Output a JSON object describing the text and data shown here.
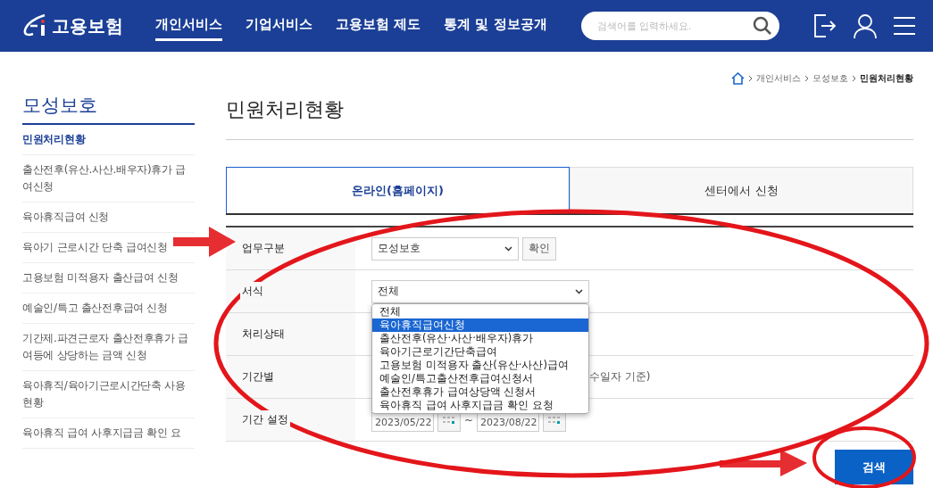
{
  "header": {
    "logo": "고용보험",
    "nav": [
      {
        "label": "개인서비스",
        "selected": true
      },
      {
        "label": "기업서비스",
        "selected": false
      },
      {
        "label": "고용보험 제도",
        "selected": false
      },
      {
        "label": "통계 및 정보공개",
        "selected": false
      }
    ],
    "search": {
      "placeholder": "검색어를 입력하세요."
    }
  },
  "breadcrumb": [
    "개인서비스",
    "모성보호",
    "민원처리현황"
  ],
  "sidebar": {
    "title": "모성보호",
    "items": [
      {
        "label": "민원처리현황",
        "selected": true
      },
      {
        "label": "출산전후(유산.사산.배우자)휴가 급여신청",
        "selected": false
      },
      {
        "label": "육아휴직급여 신청",
        "selected": false
      },
      {
        "label": "육아기 근로시간 단축 급여신청",
        "selected": false
      },
      {
        "label": "고용보험 미적용자 출산급여 신청",
        "selected": false
      },
      {
        "label": "예술인/특고 출산전후급여 신청",
        "selected": false
      },
      {
        "label": "기간제.파견근로자 출산전후휴가 급여등에 상당하는 금액 신청",
        "selected": false
      },
      {
        "label": "육아휴직/육아기근로시간단축 사용현황",
        "selected": false
      },
      {
        "label": "육아휴직 급여 사후지급금 확인 요",
        "selected": false
      }
    ]
  },
  "page_title": "민원처리현황",
  "tabs": [
    {
      "label": "온라인(홈페이지)",
      "selected": true
    },
    {
      "label": "센터에서 신청",
      "selected": false
    }
  ],
  "form": {
    "rows": [
      {
        "kind": "select_confirm",
        "label": "업무구분",
        "value": "모성보호",
        "button": "확인"
      },
      {
        "kind": "select",
        "label": "서식",
        "value": "전체"
      },
      {
        "kind": "blank",
        "label": "처리상태"
      },
      {
        "kind": "note",
        "label": "기간별",
        "note": "수일자 기준)"
      },
      {
        "kind": "date_range",
        "label": "기간 설정",
        "from": "2023/05/22",
        "separator": "~",
        "to": "2023/08/22"
      }
    ],
    "dropdown": [
      {
        "label": "전체",
        "selected": false
      },
      {
        "label": "육아휴직급여신청",
        "selected": true
      },
      {
        "label": "출산전후(유산·사산·배우자)휴가",
        "selected": false
      },
      {
        "label": "육아기근로기간단축급여",
        "selected": false
      },
      {
        "label": "고용보험 미적용자 출산(유산·사산)급여",
        "selected": false
      },
      {
        "label": "예술인/특고출산전후급여신청서",
        "selected": false
      },
      {
        "label": "출산전후휴가 급여상당액 신청서",
        "selected": false
      },
      {
        "label": "육아휴직 급여 사후지급금 확인 요청",
        "selected": false
      }
    ]
  },
  "search_button": "검색"
}
